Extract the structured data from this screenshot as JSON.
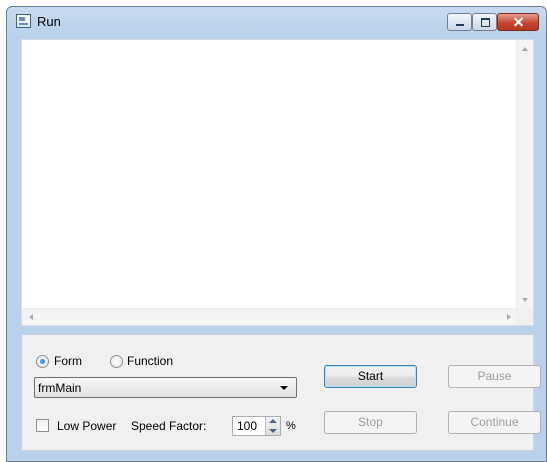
{
  "window": {
    "title": "Run"
  },
  "mode": {
    "options": [
      "Form",
      "Function"
    ],
    "selected": "Form"
  },
  "target": {
    "selected": "frmMain"
  },
  "options": {
    "low_power_label": "Low Power",
    "low_power_checked": false,
    "speed_factor_label": "Speed Factor:",
    "speed_factor_value": "100",
    "speed_factor_unit": "%"
  },
  "buttons": {
    "start": "Start",
    "pause": "Pause",
    "stop": "Stop",
    "continue": "Continue"
  },
  "icons": {
    "app": "run-window-icon",
    "minimize": "minimize-icon",
    "maximize": "maximize-icon",
    "close": "close-icon"
  }
}
